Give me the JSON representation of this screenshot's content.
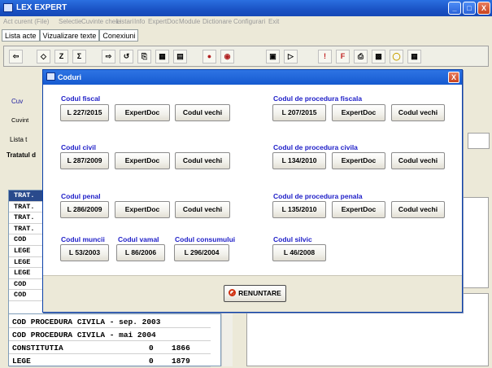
{
  "window": {
    "title": "LEX EXPERT",
    "minimize": "_",
    "maximize": "□",
    "close": "X"
  },
  "menu": [
    "Act curent (File)",
    "Selectie",
    "Cuvinte cheie",
    "Listari",
    "Info",
    "ExpertDoc",
    "Module",
    "Dictionare",
    "Configurari",
    "Exit"
  ],
  "tabs": [
    "Lista acte",
    "Vizualizare texte",
    "Conexiuni"
  ],
  "background": {
    "left_cut_labels": [
      "Cuv",
      "Cuvint",
      "Lista t",
      "Tratatul d"
    ],
    "left_rows": [
      "TRAT.",
      "TRAT.",
      "TRAT.",
      "TRAT.",
      "COD",
      "LEGE",
      "LEGE",
      "LEGE",
      "COD",
      "COD"
    ],
    "rows": [
      {
        "name": "COD PROCEDURA CIVILA - sep. 2003",
        "n1": "",
        "n2": ""
      },
      {
        "name": "COD PROCEDURA CIVILA - mai 2004",
        "n1": "",
        "n2": ""
      },
      {
        "name": "CONSTITUTIA",
        "n1": "0",
        "n2": "1866"
      },
      {
        "name": "LEGE",
        "n1": "0",
        "n2": "1879"
      }
    ]
  },
  "dialog": {
    "title": "Coduri",
    "close": "X",
    "groups": [
      {
        "label": "Codul fiscal",
        "buttons": [
          "L 227/2015",
          "ExpertDoc",
          "Codul vechi"
        ]
      },
      {
        "label": "Codul de procedura fiscala",
        "buttons": [
          "L 207/2015",
          "ExpertDoc",
          "Codul vechi"
        ]
      },
      {
        "label": "Codul civil",
        "buttons": [
          "L 287/2009",
          "ExpertDoc",
          "Codul vechi"
        ]
      },
      {
        "label": "Codul de procedura civila",
        "buttons": [
          "L 134/2010",
          "ExpertDoc",
          "Codul vechi"
        ]
      },
      {
        "label": "Codul penal",
        "buttons": [
          "L 286/2009",
          "ExpertDoc",
          "Codul vechi"
        ]
      },
      {
        "label": "Codul de procedura penala",
        "buttons": [
          "L 135/2010",
          "ExpertDoc",
          "Codul vechi"
        ]
      },
      {
        "label": "Codul muncii",
        "buttons": [
          "L 53/2003"
        ]
      },
      {
        "label": "Codul vamal",
        "buttons": [
          "L 86/2006"
        ]
      },
      {
        "label": "Codul consumului",
        "buttons": [
          "L 296/2004"
        ]
      },
      {
        "label": "Codul silvic",
        "buttons": [
          "L 46/2008"
        ]
      }
    ],
    "cancel_label": "RENUNTARE"
  }
}
